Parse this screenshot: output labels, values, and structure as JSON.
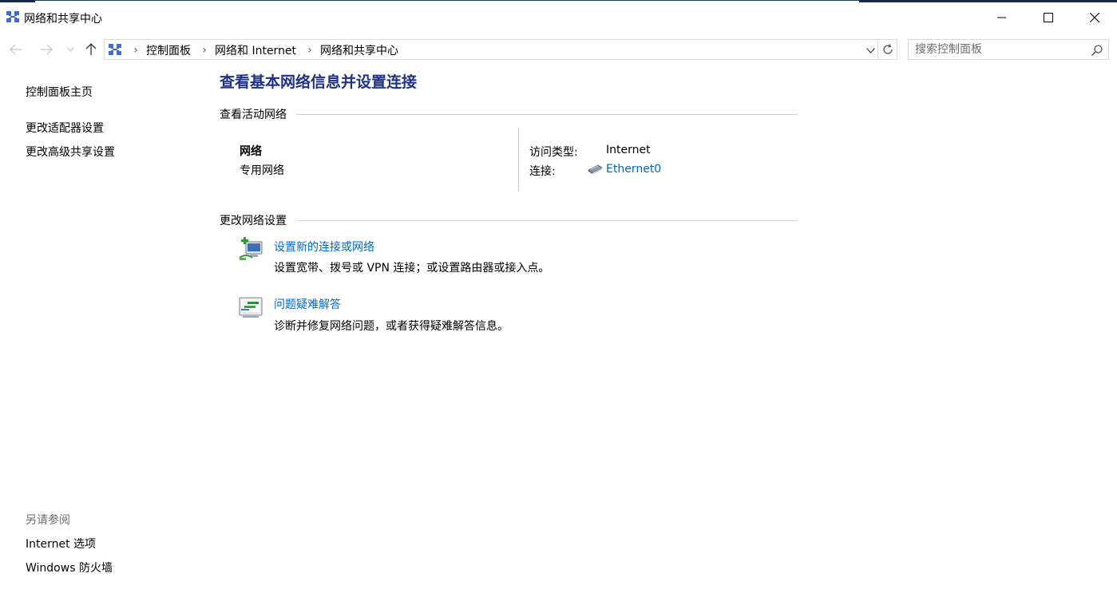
{
  "window": {
    "title": "网络和共享中心",
    "icon": "network-center-icon",
    "controls": [
      "minimize",
      "maximize",
      "close"
    ]
  },
  "nav": {
    "back": "back-arrow-icon",
    "forward": "forward-arrow-icon",
    "recent": "chevron-down-icon",
    "up": "up-arrow-icon"
  },
  "address": {
    "breadcrumbs": [
      "控制面板",
      "网络和 Internet",
      "网络和共享中心"
    ]
  },
  "search": {
    "placeholder": "搜索控制面板"
  },
  "sidebar": {
    "home": "控制面板主页",
    "links": [
      "更改适配器设置",
      "更改高级共享设置"
    ],
    "see_also_title": "另请参阅",
    "see_also": [
      "Internet 选项",
      "Windows 防火墙"
    ]
  },
  "main": {
    "title": "查看基本网络信息并设置连接",
    "active_section": "查看活动网络",
    "network": {
      "name": "网络",
      "type": "专用网络",
      "access_label": "访问类型:",
      "access_value": "Internet",
      "connection_label": "连接:",
      "connection_value": "Ethernet0"
    },
    "change_section": "更改网络设置",
    "tasks": [
      {
        "icon": "new-connection-icon",
        "title": "设置新的连接或网络",
        "desc": "设置宽带、拨号或 VPN 连接；或设置路由器或接入点。"
      },
      {
        "icon": "troubleshoot-icon",
        "title": "问题疑难解答",
        "desc": "诊断并修复网络问题，或者获得疑难解答信息。"
      }
    ]
  },
  "colors": {
    "link": "#0066cc",
    "page_title": "#1e3287",
    "divider": "#cfcfcf"
  }
}
